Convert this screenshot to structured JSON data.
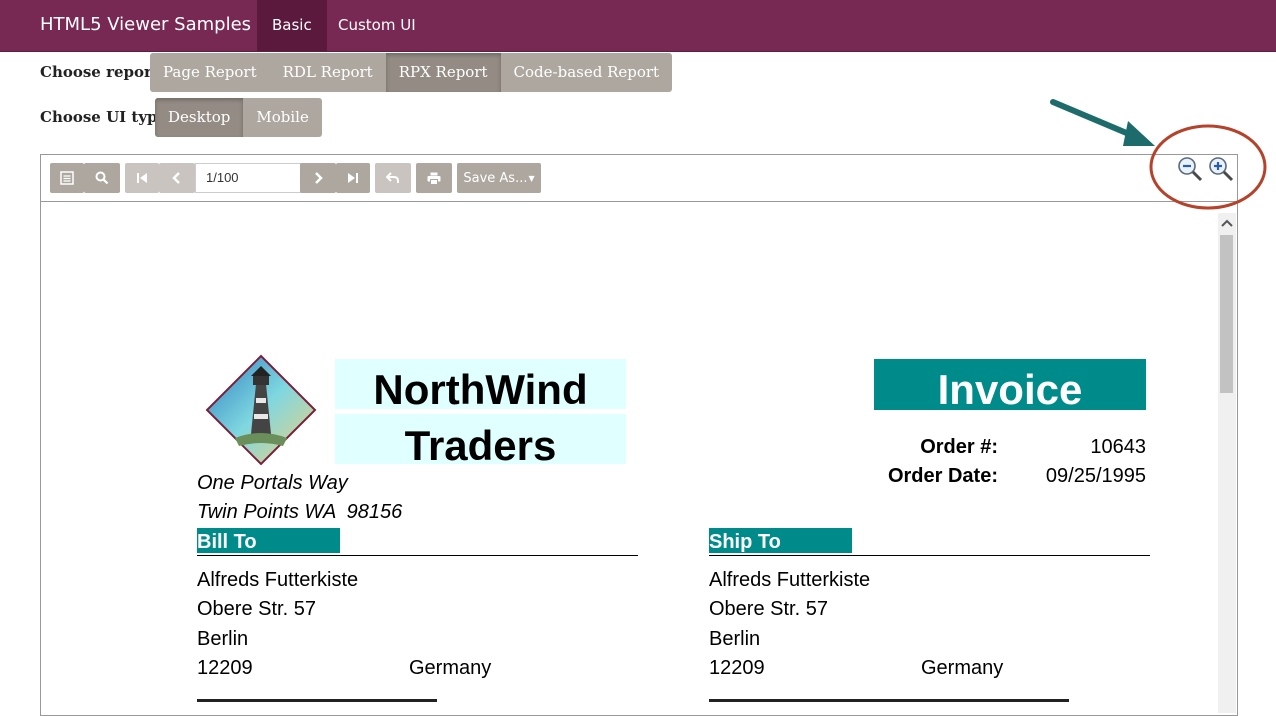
{
  "nav": {
    "brand": "HTML5 Viewer Samples",
    "tabs": [
      {
        "label": "Basic",
        "active": true
      },
      {
        "label": "Custom UI",
        "active": false
      }
    ]
  },
  "choose_report": {
    "label": "Choose report :",
    "options": [
      "Page Report",
      "RDL Report",
      "RPX Report",
      "Code-based Report"
    ],
    "selected": "RPX Report"
  },
  "choose_ui": {
    "label": "Choose UI type :",
    "options": [
      "Desktop",
      "Mobile"
    ],
    "selected": "Desktop"
  },
  "toolbar": {
    "page_value": "1/100",
    "save_as_label": "Save As...",
    "icons": [
      "toc-icon",
      "search-icon",
      "first-page-icon",
      "prev-page-icon",
      "next-page-icon",
      "last-page-icon",
      "back-icon",
      "print-icon",
      "zoom-out-icon",
      "zoom-in-icon"
    ]
  },
  "report": {
    "company_line1": "NorthWind",
    "company_line2": "Traders",
    "address_line1": "One Portals Way",
    "address_line2": "Twin Points WA  98156",
    "invoice_title": "Invoice",
    "order_no_label": "Order #:",
    "order_no_value": "10643",
    "order_date_label": "Order Date:",
    "order_date_value": "09/25/1995",
    "bill_to": {
      "heading": "Bill To",
      "name": "Alfreds Futterkiste",
      "street": "Obere Str. 57",
      "city": "Berlin",
      "postal": "12209",
      "country": "Germany"
    },
    "ship_to": {
      "heading": "Ship To",
      "name": "Alfreds Futterkiste",
      "street": "Obere Str. 57",
      "city": "Berlin",
      "postal": "12209",
      "country": "Germany"
    }
  },
  "colors": {
    "nav_bg": "#772953",
    "button_bg": "#aea79f",
    "teal": "#008b8b",
    "company_box": "#e0ffff",
    "annotation": "#b5432b",
    "arrow": "#1d6b6b"
  }
}
